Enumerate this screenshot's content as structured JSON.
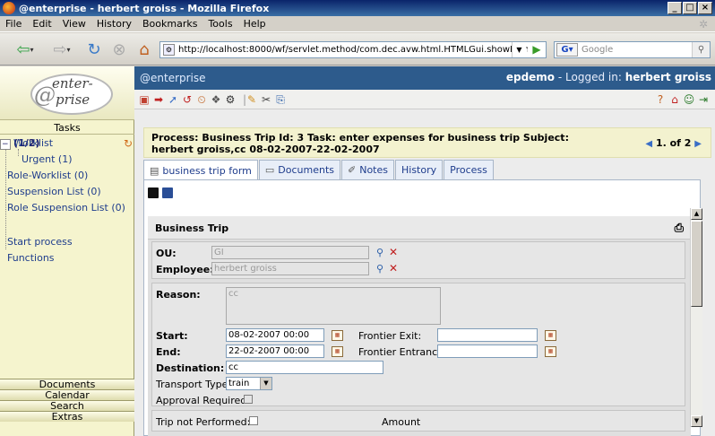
{
  "window": {
    "title": "@enterprise - herbert groiss - Mozilla Firefox"
  },
  "menu": [
    "File",
    "Edit",
    "View",
    "History",
    "Bookmarks",
    "Tools",
    "Help"
  ],
  "browser": {
    "url": "http://localhost:8000/wf/servlet.method/com.dec.avw.html.HTMLGui.showFrames?time=117",
    "search_placeholder": "Google"
  },
  "sidebar": {
    "logo_line1": "enter-",
    "logo_line2": "prise",
    "logo_at": "@",
    "tasks_header": "Tasks",
    "worklist_label": "Worklist",
    "worklist_count": "(1/2)",
    "urgent": "Urgent (1)",
    "role_worklist": "Role-Worklist (0)",
    "suspension": "Suspension List (0)",
    "role_suspension": "Role Suspension List (0)",
    "start_process": "Start process",
    "functions": "Functions",
    "bottom_items": [
      "Documents",
      "Calendar",
      "Search",
      "Extras"
    ]
  },
  "header": {
    "brand": "@enterprise",
    "user_prefix": "epdemo",
    "logged_in_text": " - Logged in: ",
    "user_name": "herbert groiss"
  },
  "process": {
    "line1": "Process: Business Trip   Id: 3   Task: enter expenses for business trip   Subject:",
    "line2": "herbert groiss,cc 08-02-2007-22-02-2007",
    "pager": "1. of 2"
  },
  "tabs": [
    "business trip form",
    "Documents",
    "Notes",
    "History",
    "Process"
  ],
  "form": {
    "section_title": "Business Trip",
    "ou_label": "OU:",
    "ou_value": "GI",
    "employee_label": "Employee:",
    "employee_value": "herbert groiss",
    "reason_label": "Reason:",
    "reason_value": "cc",
    "start_label": "Start:",
    "start_value": "08-02-2007 00:00",
    "end_label": "End:",
    "end_value": "22-02-2007 00:00",
    "frontier_exit_label": "Frontier Exit:",
    "frontier_entrance_label": "Frontier Entrance:",
    "destination_label": "Destination:",
    "destination_value": "cc",
    "transport_label": "Transport Type:",
    "transport_value": "train",
    "approval_label": "Approval Required:",
    "not_performed_label": "Trip not Performed:",
    "amount_label": "Amount"
  }
}
